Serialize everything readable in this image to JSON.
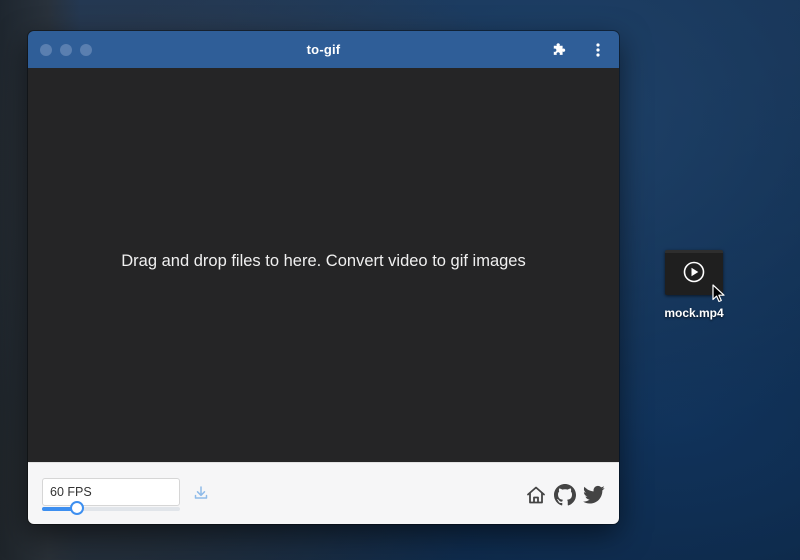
{
  "window": {
    "title": "to-gif"
  },
  "titlebar": {
    "extension_icon": "puzzle-piece-icon",
    "menu_icon": "more-vertical-icon"
  },
  "dropzone": {
    "text": "Drag and drop files to here. Convert video to gif images"
  },
  "footer": {
    "fps_value": "60 FPS",
    "fps_slider_fraction": 0.25,
    "download_icon": "download-icon",
    "links": [
      "home-icon",
      "github-icon",
      "twitter-icon"
    ]
  },
  "desktop": {
    "file_name": "mock.mp4",
    "file_icon": "video-file-icon"
  },
  "colors": {
    "titlebar": "#2f5e98",
    "dropzone": "#252526",
    "footer": "#f6f6f7",
    "accent": "#3d8ff0"
  }
}
